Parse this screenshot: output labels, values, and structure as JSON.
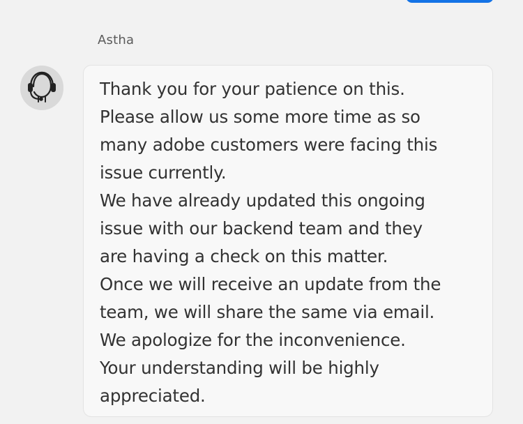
{
  "chat": {
    "sender_name": "Astha",
    "avatar_icon": "headset-agent-icon",
    "message_lines": [
      "Thank you for your patience on this.",
      "Please allow us some more time as so",
      "many adobe customers were facing this",
      "issue currently.",
      "We have already updated this ongoing",
      "issue with our backend team and they",
      "are having a check on this matter.",
      "Once we will receive an update from the",
      "team, we will share the same via email.",
      "We apologize for the inconvenience.",
      "Your understanding will be highly",
      "appreciated."
    ]
  },
  "colors": {
    "background": "#f2f2f2",
    "bubble": "#f8f8f8",
    "accent": "#1473e6",
    "text": "#323232"
  }
}
